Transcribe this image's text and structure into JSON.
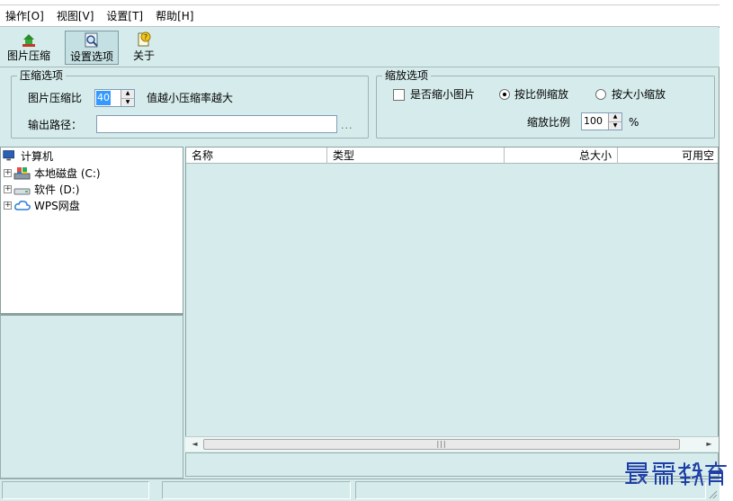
{
  "menu": [
    {
      "label": "操作[O]"
    },
    {
      "label": "视图[V]"
    },
    {
      "label": "设置[T]"
    },
    {
      "label": "帮助[H]"
    }
  ],
  "toolbar": {
    "compress_label": "图片压缩",
    "settings_label": "设置选项",
    "about_label": "关于"
  },
  "compress": {
    "legend": "压缩选项",
    "ratio_label": "图片压缩比",
    "ratio_value": "40",
    "ratio_hint": "值越小压缩率越大",
    "output_label": "输出路径：",
    "output_value": "",
    "browse_label": "..."
  },
  "scale": {
    "legend": "缩放选项",
    "shrink_label": "是否缩小图片",
    "shrink_checked": false,
    "by_ratio_label": "按比例缩放",
    "by_size_label": "按大小缩放",
    "selected_mode": "by_ratio",
    "ratio_label": "缩放比例",
    "ratio_value": "100",
    "ratio_unit": "%"
  },
  "tree": {
    "root": "计算机",
    "items": [
      {
        "label": "本地磁盘 (C:)"
      },
      {
        "label": "软件 (D:)"
      },
      {
        "label": "WPS网盘"
      }
    ]
  },
  "list": {
    "columns": [
      "名称",
      "类型",
      "总大小",
      "可用空"
    ]
  },
  "colors": {
    "panel": "#d6ecec",
    "selection": "#3399ff",
    "watermark": "#1f3fa8"
  },
  "watermark": "最需教育"
}
